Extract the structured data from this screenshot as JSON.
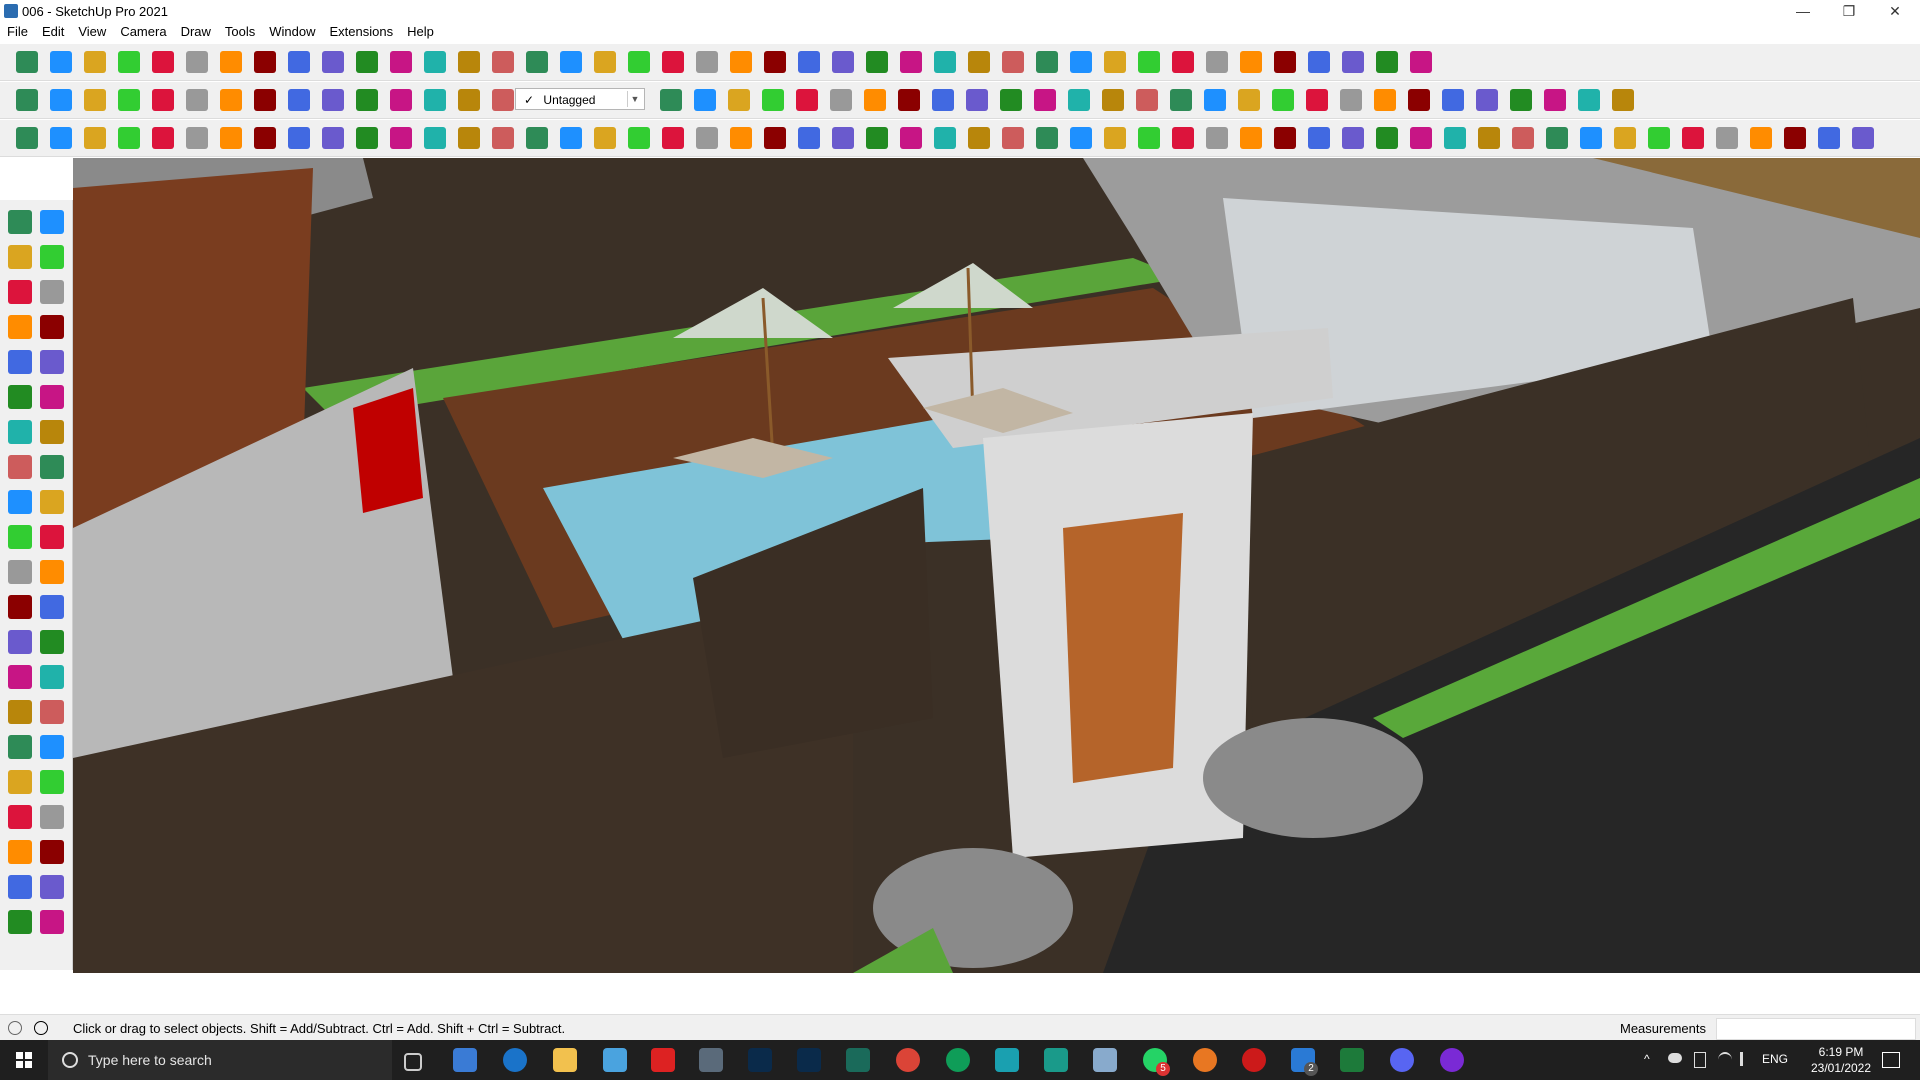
{
  "window": {
    "title": "006 - SketchUp Pro 2021",
    "controls": [
      "—",
      "❐",
      "✕"
    ]
  },
  "menu": [
    "File",
    "Edit",
    "View",
    "Camera",
    "Draw",
    "Tools",
    "Window",
    "Extensions",
    "Help"
  ],
  "toolbar": {
    "tag_value": "Untagged",
    "tag_check": "✓"
  },
  "status": {
    "message": "Click or drag to select objects. Shift = Add/Subtract. Ctrl = Add. Shift + Ctrl = Subtract.",
    "measurements_label": "Measurements",
    "measurements_value": ""
  },
  "taskbar": {
    "search_placeholder": "Type here to search",
    "language": "ENG",
    "time": "6:19 PM",
    "date": "23/01/2022",
    "badges": {
      "whatsapp": "5",
      "tasks": "2"
    }
  }
}
